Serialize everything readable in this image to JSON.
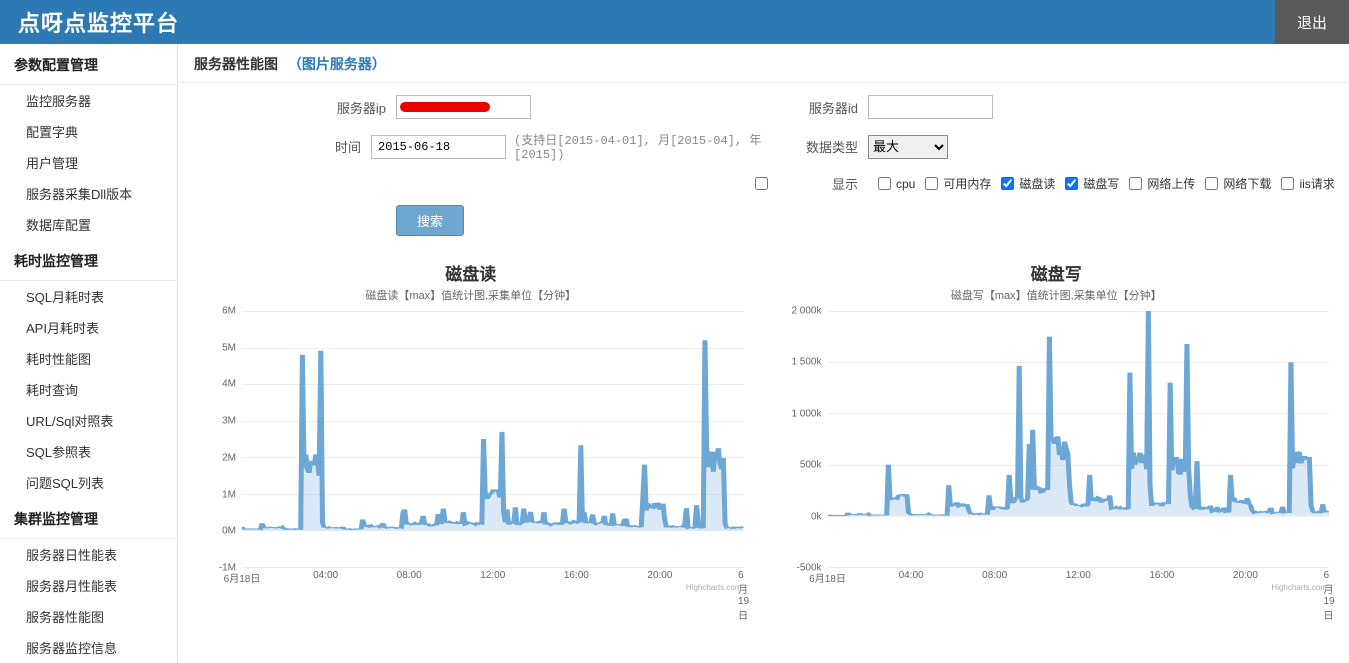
{
  "topbar": {
    "title": "点呀点监控平台",
    "logout": "退出"
  },
  "sidebar": {
    "group1": {
      "header": "参数配置管理",
      "items": [
        "监控服务器",
        "配置字典",
        "用户管理",
        "服务器采集Dll版本",
        "数据库配置"
      ]
    },
    "group2": {
      "header": "耗时监控管理",
      "items": [
        "SQL月耗时表",
        "API月耗时表",
        "耗时性能图",
        "耗时查询",
        "URL/Sql对照表",
        "SQL参照表",
        "问题SQL列表"
      ]
    },
    "group3": {
      "header": "集群监控管理",
      "items": [
        "服务器日性能表",
        "服务器月性能表",
        "服务器性能图",
        "服务器监控信息"
      ]
    }
  },
  "breadcrumb": {
    "t1": "服务器性能图",
    "t2": "（图片服务器）"
  },
  "form": {
    "ip_label": "服务器ip",
    "id_label": "服务器id",
    "time_label": "时间",
    "time_value": "2015-06-18",
    "time_hint": "(支持日[2015-04-01], 月[2015-04], 年[2015])",
    "datatype_label": "数据类型",
    "datatype_value": "最大",
    "display_label": "显示",
    "checks": {
      "cpu": {
        "label": "cpu",
        "checked": false
      },
      "mem": {
        "label": "可用内存",
        "checked": false
      },
      "diskr": {
        "label": "磁盘读",
        "checked": true
      },
      "diskw": {
        "label": "磁盘写",
        "checked": true
      },
      "netup": {
        "label": "网络上传",
        "checked": false
      },
      "netdn": {
        "label": "网络下载",
        "checked": false
      },
      "iis": {
        "label": "iis请求",
        "checked": false
      }
    },
    "search_btn": "搜索"
  },
  "chart_data": [
    {
      "type": "line",
      "title": "磁盘读",
      "subtitle": "磁盘读【max】值统计图,采集单位【分钟】",
      "ylim": [
        -1000000,
        6000000
      ],
      "yticks": [
        -1000000,
        0,
        1000000,
        2000000,
        3000000,
        4000000,
        5000000,
        6000000
      ],
      "yticklabels": [
        "-1M",
        "0M",
        "1M",
        "2M",
        "3M",
        "4M",
        "5M",
        "6M"
      ],
      "x_start": "2015-06-18 00:00",
      "x_end": "2015-06-19 00:00",
      "xticklabels": [
        "6月18日",
        "04:00",
        "08:00",
        "12:00",
        "16:00",
        "20:00",
        "6月19日"
      ],
      "series": [
        {
          "name": "磁盘读",
          "sample_values_M": [
            0.1,
            0.2,
            0.1,
            4.8,
            0.2,
            0.1,
            0.3,
            0.2,
            0.5,
            0.4,
            0.6,
            0.5,
            2.5,
            0.5,
            0.6,
            0.5,
            0.6,
            0.5,
            0.4,
            0.3,
            1.8,
            0.3,
            0.2,
            5.2,
            0.2
          ]
        }
      ],
      "credit": "Highcharts.com"
    },
    {
      "type": "line",
      "title": "磁盘写",
      "subtitle": "磁盘写【max】值统计图,采集单位【分钟】",
      "ylim": [
        -500000,
        2000000
      ],
      "yticks": [
        -500000,
        0,
        500000,
        1000000,
        1500000,
        2000000
      ],
      "yticklabels": [
        "-500k",
        "0k",
        "500k",
        "1 000k",
        "1 500k",
        "2 000k"
      ],
      "x_start": "2015-06-18 00:00",
      "x_end": "2015-06-19 00:00",
      "xticklabels": [
        "6月18日",
        "04:00",
        "08:00",
        "12:00",
        "16:00",
        "20:00",
        "6月19日"
      ],
      "series": [
        {
          "name": "磁盘写",
          "sample_values_k": [
            10,
            30,
            20,
            500,
            30,
            20,
            300,
            50,
            200,
            400,
            700,
            1750,
            300,
            400,
            200,
            1400,
            300,
            1300,
            200,
            100,
            400,
            100,
            80,
            1500,
            100
          ]
        }
      ],
      "credit": "Highcharts.com"
    }
  ]
}
